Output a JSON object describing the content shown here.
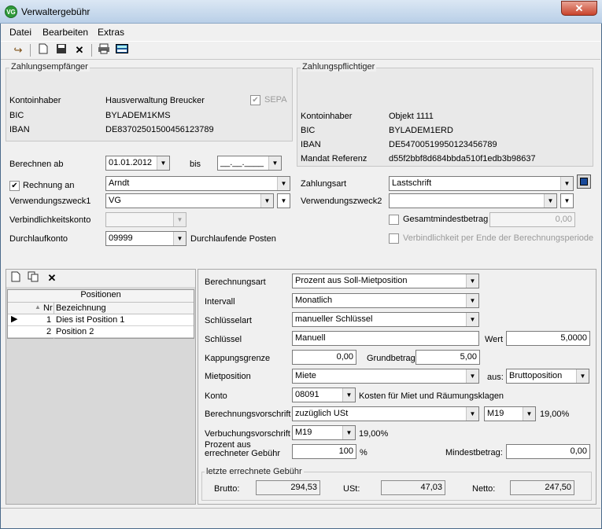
{
  "window": {
    "title": "Verwaltergebühr",
    "icon_text": "VG",
    "close": "✕"
  },
  "menu": [
    "Datei",
    "Bearbeiten",
    "Extras"
  ],
  "payee": {
    "legend": "Zahlungsempfänger",
    "owner_label": "Kontoinhaber",
    "owner": "Hausverwaltung Breucker",
    "bic_label": "BIC",
    "bic": "BYLADEM1KMS",
    "iban_label": "IBAN",
    "iban": "DE83702501500456123789",
    "sepa_label": "SEPA"
  },
  "payer": {
    "legend": "Zahlungspflichtiger",
    "owner_label": "Kontoinhaber",
    "owner": "Objekt 1111",
    "bic_label": "BIC",
    "bic": "BYLADEM1ERD",
    "iban_label": "IBAN",
    "iban": "DE54700519950123456789",
    "mandate_label": "Mandat Referenz",
    "mandate": "d55f2bbf8d684bbda510f1edb3b98637"
  },
  "form": {
    "calc_from_label": "Berechnen ab",
    "calc_from": "01.01.2012",
    "to_label": "bis",
    "to": "__.__.____",
    "invoice_label": "Rechnung an",
    "invoice_to": "Arndt",
    "purpose1_label": "Verwendungszweck1",
    "purpose1": "VG",
    "liability_label": "Verbindlichkeitskonto",
    "liability": "",
    "transit_label": "Durchlaufkonto",
    "transit": "09999",
    "transit_desc": "Durchlaufende Posten",
    "payment_type_label": "Zahlungsart",
    "payment_type": "Lastschrift",
    "purpose2_label": "Verwendungszweck2",
    "purpose2": "",
    "min_total_label": "Gesamtmindestbetrag",
    "min_total": "0,00",
    "liability_end_label": "Verbindlichkeit per Ende der Berechnungsperiode"
  },
  "positions": {
    "header": "Positionen",
    "col_nr": "Nr",
    "col_name": "Bezeichnung",
    "rows": [
      {
        "nr": "1",
        "name": "Dies ist Position 1"
      },
      {
        "nr": "2",
        "name": "Position 2"
      }
    ]
  },
  "detail": {
    "calc_type_label": "Berechnungsart",
    "calc_type": "Prozent aus Soll-Mietposition",
    "interval_label": "Intervall",
    "interval": "Monatlich",
    "key_type_label": "Schlüsselart",
    "key_type": "manueller Schlüssel",
    "key_label": "Schlüssel",
    "key": "Manuell",
    "value_label": "Wert",
    "value": "5,0000",
    "cap_label": "Kappungsgrenze",
    "cap": "0,00",
    "base_label": "Grundbetrag",
    "base": "5,00",
    "rent_pos_label": "Mietposition",
    "rent_pos": "Miete",
    "from_label": "aus:",
    "from": "Bruttoposition",
    "account_label": "Konto",
    "account": "08091",
    "account_desc": "Kosten für Miet und Räumungsklagen",
    "calc_rule_label": "Berechnungsvorschrift",
    "calc_rule": "zuzüglich USt",
    "calc_tax": "M19",
    "calc_tax_pct": "19,00%",
    "booking_rule_label": "Verbuchungsvorschrift",
    "booking_tax": "M19",
    "booking_tax_pct": "19,00%",
    "percent_label1": "Prozent aus",
    "percent_label2": "errechneter Gebühr",
    "percent": "100",
    "percent_unit": "%",
    "min_label": "Mindestbetrag:",
    "min": "0,00"
  },
  "last": {
    "legend": "letzte errechnete Gebühr",
    "gross_label": "Brutto:",
    "gross": "294,53",
    "vat_label": "USt:",
    "vat": "47,03",
    "net_label": "Netto:",
    "net": "247,50"
  }
}
